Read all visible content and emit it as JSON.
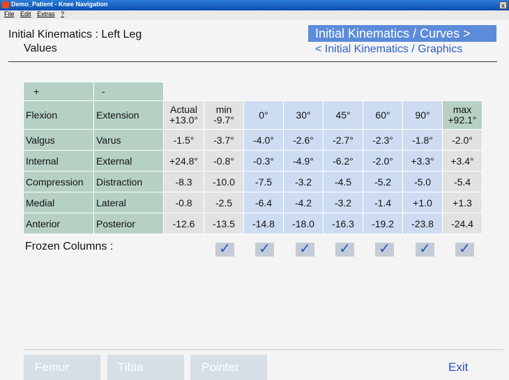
{
  "window": {
    "title": "Demo_Patient - Knee Navigation",
    "close_label": "x"
  },
  "menu": [
    "File",
    "Edit",
    "Extras",
    "?"
  ],
  "header": {
    "title": "Initial Kinematics : Left Leg",
    "subtitle": "Values",
    "nav_current": "Initial Kinematics / Curves >",
    "nav_link": "< Initial Kinematics / Graphics"
  },
  "table": {
    "plus_label": "+",
    "minus_label": "-",
    "headers": {
      "pos": "Flexion",
      "neg": "Extension",
      "actual": [
        "Actual",
        "+13.0°"
      ],
      "min": [
        "min",
        "-9.7°"
      ],
      "angles": [
        "0°",
        "30°",
        "45°",
        "60°",
        "90°"
      ],
      "max": [
        "max",
        "+92.1°"
      ]
    },
    "rows": [
      {
        "pos": "Valgus",
        "neg": "Varus",
        "values": [
          "-1.5°",
          "-3.7°",
          "-4.0°",
          "-2.6°",
          "-2.7°",
          "-2.3°",
          "-1.8°",
          "-2.0°"
        ]
      },
      {
        "pos": "Internal",
        "neg": "External",
        "values": [
          "+24.8°",
          "-0.8°",
          "-0.3°",
          "-4.9°",
          "-6.2°",
          "-2.0°",
          "+3.3°",
          "+3.4°"
        ]
      },
      {
        "pos": "Compression",
        "neg": "Distraction",
        "values": [
          "-8.3",
          "-10.0",
          "-7.5",
          "-3.2",
          "-4.5",
          "-5.2",
          "-5.0",
          "-5.4"
        ]
      },
      {
        "pos": "Medial",
        "neg": "Lateral",
        "values": [
          "-0.8",
          "-2.5",
          "-6.4",
          "-4.2",
          "-3.2",
          "-1.4",
          "+1.0",
          "+1.3"
        ]
      },
      {
        "pos": "Anterior",
        "neg": "Posterior",
        "values": [
          "-12.6",
          "-13.5",
          "-14.8",
          "-18.0",
          "-16.3",
          "-19.2",
          "-23.8",
          "-24.4"
        ]
      }
    ]
  },
  "frozen": {
    "label": "Frozen Columns :",
    "checks": [
      true,
      true,
      true,
      true,
      true,
      true,
      true
    ]
  },
  "footer": {
    "femur": "Femur",
    "tibia": "Tibia",
    "pointer": "Pointer",
    "exit": "Exit"
  },
  "colors": {
    "accent": "#5b8bd9",
    "link": "#2d5fd1",
    "label_bg": "#b6d1c4",
    "frozen_bg": "#cedcf2"
  }
}
